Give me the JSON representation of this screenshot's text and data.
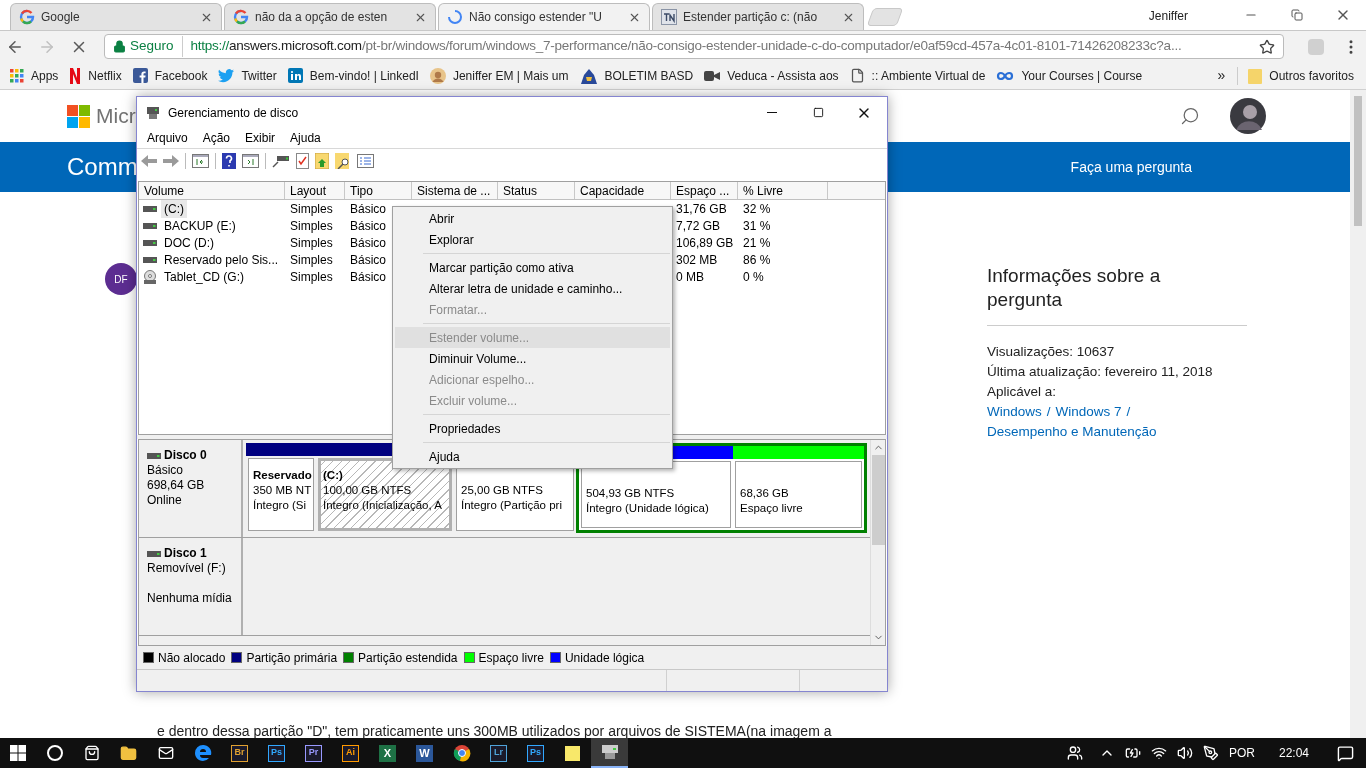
{
  "browser": {
    "profile": "Jeniffer",
    "tabs": [
      {
        "kind": "google",
        "title": "Google",
        "selected": false
      },
      {
        "kind": "google",
        "title": "não da a opção de esten",
        "selected": false
      },
      {
        "kind": "loading",
        "title": "Não consigo estender \"U",
        "selected": true
      },
      {
        "kind": "site",
        "title": "Estender partição c: (não",
        "selected": false
      }
    ],
    "address": {
      "secure_label": "Seguro",
      "scheme": "https://",
      "host": "answers.microsoft.com",
      "path": "/pt-br/windows/forum/windows_7-performance/não-consigo-estender-unidade-c-do-computador/e0af59cd-457a-4c01-8101-71426208233c?a..."
    },
    "bookmarks": [
      {
        "kind": "apps",
        "label": "Apps"
      },
      {
        "kind": "netflix",
        "label": "Netflix"
      },
      {
        "kind": "facebook",
        "label": "Facebook"
      },
      {
        "kind": "twitter",
        "label": "Twitter"
      },
      {
        "kind": "linkedin",
        "label": "Bem-vindo! | LinkedI"
      },
      {
        "kind": "avatar",
        "label": "Jeniffer EM | Mais um"
      },
      {
        "kind": "mascot",
        "label": "BOLETIM BASD"
      },
      {
        "kind": "video",
        "label": "Veduca - Assista aos"
      },
      {
        "kind": "page",
        "label": ":: Ambiente Virtual de"
      },
      {
        "kind": "loop",
        "label": "Your Courses | Course"
      }
    ],
    "more": "»",
    "other_bookmarks": "Outros favoritos"
  },
  "page": {
    "logo_text": "Micr",
    "banner_title": "Comm",
    "ask_button": "Faça uma pergunta",
    "author_initials": "DF",
    "info": {
      "heading": "Informações sobre a pergunta",
      "views": "Visualizações: 10637",
      "updated": "Última atualização: fevereiro 11, 2018",
      "applies_label": "Aplicável a:",
      "separator": "/",
      "links": [
        "Windows",
        "Windows 7",
        "Desempenho e Manutenção"
      ]
    },
    "body_text": "e dentro dessa partição \"D\", tem praticamente uns 300MB utilizados por arquivos de SISTEMA(na imagem a"
  },
  "dialog": {
    "title": "Gerenciamento de disco",
    "menu": [
      "Arquivo",
      "Ação",
      "Exibir",
      "Ajuda"
    ],
    "columns": [
      "Volume",
      "Layout",
      "Tipo",
      "Sistema de ...",
      "Status",
      "Capacidade",
      "Espaço ...",
      "% Livre"
    ],
    "rows": [
      {
        "kind": "disk",
        "volume": "(C:)",
        "layout": "Simples",
        "type": "Básico",
        "free": "31,76 GB",
        "percent": "32 %",
        "selected": true
      },
      {
        "kind": "disk",
        "volume": "BACKUP (E:)",
        "layout": "Simples",
        "type": "Básico",
        "free": "7,72 GB",
        "percent": "31 %",
        "selected": false
      },
      {
        "kind": "disk",
        "volume": "DOC (D:)",
        "layout": "Simples",
        "type": "Básico",
        "free": "106,89 GB",
        "percent": "21 %",
        "selected": false
      },
      {
        "kind": "disk",
        "volume": "Reservado pelo Sis...",
        "layout": "Simples",
        "type": "Básico",
        "free": "302 MB",
        "percent": "86 %",
        "selected": false
      },
      {
        "kind": "cd",
        "volume": "Tablet_CD (G:)",
        "layout": "Simples",
        "type": "Básico",
        "free": "0 MB",
        "percent": "0 %",
        "selected": false
      }
    ],
    "disks": [
      {
        "name": "Disco 0",
        "type": "Básico",
        "size": "698,64 GB",
        "status": "Online",
        "partitions": [
          {
            "kind": "primary",
            "name": "Reservado",
            "size": "350 MB NT",
            "status": "Íntegro (Si",
            "selected": false
          },
          {
            "kind": "primary",
            "name": "(C:)",
            "size": "100,00 GB NTFS",
            "status": "Íntegro (Inicialização, A",
            "selected": true
          },
          {
            "kind": "primary",
            "size": "25,00 GB NTFS",
            "status": "Íntegro (Partição pri",
            "selected": false
          },
          {
            "kind": "extended",
            "children": [
              {
                "kind": "logical",
                "size": "504,93 GB NTFS",
                "status": "Íntegro (Unidade lógica)",
                "selected": false
              },
              {
                "kind": "free",
                "size": "68,36 GB",
                "status": "Espaço livre",
                "selected": false
              }
            ]
          }
        ]
      },
      {
        "name": "Disco 1",
        "type": "Removível (F:)",
        "status": "Nenhuma mídia"
      }
    ],
    "legend": [
      {
        "label": "Não alocado",
        "color": "#000000"
      },
      {
        "label": "Partição primária",
        "color": "#000080"
      },
      {
        "label": "Partição estendida",
        "color": "#008000"
      },
      {
        "label": "Espaço livre",
        "color": "#00ff00"
      },
      {
        "label": "Unidade lógica",
        "color": "#0000ff"
      }
    ]
  },
  "context_menu": [
    {
      "kind": "item",
      "label": "Abrir",
      "disabled": false,
      "highlighted": false
    },
    {
      "kind": "item",
      "label": "Explorar",
      "disabled": false,
      "highlighted": false
    },
    {
      "kind": "separator"
    },
    {
      "kind": "item",
      "label": "Marcar partição como ativa",
      "disabled": false,
      "highlighted": false
    },
    {
      "kind": "item",
      "label": "Alterar letra de unidade e caminho...",
      "disabled": false,
      "highlighted": false
    },
    {
      "kind": "item",
      "label": "Formatar...",
      "disabled": true,
      "highlighted": false
    },
    {
      "kind": "separator"
    },
    {
      "kind": "item",
      "label": "Estender volume...",
      "disabled": true,
      "highlighted": true
    },
    {
      "kind": "item",
      "label": "Diminuir Volume...",
      "disabled": false,
      "highlighted": false
    },
    {
      "kind": "item",
      "label": "Adicionar espelho...",
      "disabled": true,
      "highlighted": false
    },
    {
      "kind": "item",
      "label": "Excluir volume...",
      "disabled": true,
      "highlighted": false
    },
    {
      "kind": "separator"
    },
    {
      "kind": "item",
      "label": "Propriedades",
      "disabled": false,
      "highlighted": false
    },
    {
      "kind": "separator"
    },
    {
      "kind": "item",
      "label": "Ajuda",
      "disabled": false,
      "highlighted": false
    }
  ],
  "taskbar": {
    "apps": [
      {
        "kind": "search"
      },
      {
        "kind": "store"
      },
      {
        "kind": "folder"
      },
      {
        "kind": "mail"
      },
      {
        "kind": "edge"
      },
      {
        "kind": "adobe",
        "label": "Br",
        "color": "#e0a030",
        "selected": false
      },
      {
        "kind": "adobe",
        "label": "Ps",
        "color": "#31a8ff",
        "selected": false
      },
      {
        "kind": "adobe",
        "label": "Pr",
        "color": "#9999ff",
        "selected": false
      },
      {
        "kind": "adobe",
        "label": "Ai",
        "color": "#ff9a00",
        "selected": false
      },
      {
        "kind": "office",
        "label": "X",
        "color": "#1e7145",
        "selected": false
      },
      {
        "kind": "office",
        "label": "W",
        "color": "#2b579a",
        "selected": false
      },
      {
        "kind": "chrome",
        "selected": false
      },
      {
        "kind": "adobe",
        "label": "Lr",
        "color": "#4fa3d9",
        "selected": false
      },
      {
        "kind": "adobe",
        "label": "Ps",
        "color": "#31a8ff",
        "selected": false
      },
      {
        "kind": "notes",
        "selected": false
      },
      {
        "kind": "diskmgmt",
        "selected": true
      }
    ],
    "language": "POR",
    "time": "22:04"
  }
}
